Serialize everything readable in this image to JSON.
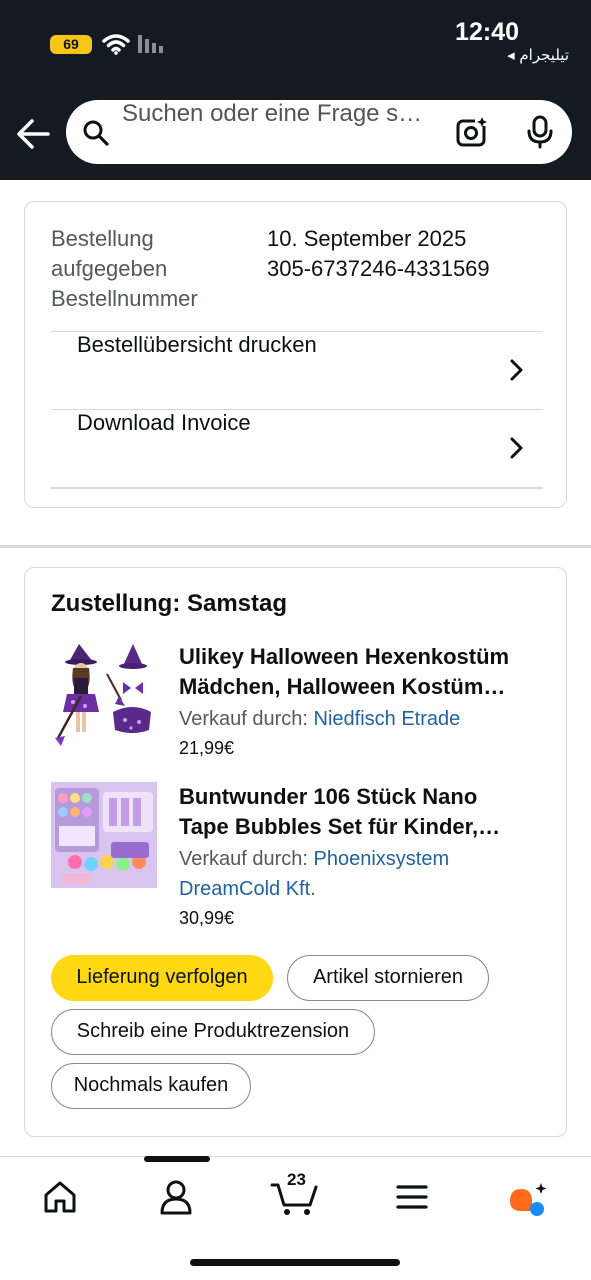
{
  "status_bar": {
    "battery": "69",
    "time": "12:40",
    "back_app": "◂ تيليجرام"
  },
  "search": {
    "placeholder": "Suchen oder eine Frage s…"
  },
  "order_info": {
    "labels": [
      "Bestellung",
      "aufgegeben",
      "Bestellnummer"
    ],
    "date": "10. September 2025",
    "number": "305-6737246-4331569",
    "actions": [
      {
        "label": "Bestellübersicht drucken"
      },
      {
        "label": "Download Invoice"
      }
    ]
  },
  "delivery": {
    "heading": "Zustellung: Samstag",
    "items": [
      {
        "title_line1": "Ulikey Halloween Hexenkostüm",
        "title_line2": "Mädchen, Halloween Kostüm…",
        "seller_prefix": "Verkauf durch: ",
        "seller_line1": "Niedfisch Etrade",
        "seller_line2": "",
        "price": "21,99€"
      },
      {
        "title_line1": "Buntwunder 106 Stück Nano",
        "title_line2": "Tape Bubbles Set für Kinder,…",
        "seller_prefix": "Verkauf durch: ",
        "seller_line1": "Phoenixsystem",
        "seller_line2": "DreamCold Kft.",
        "price": "30,99€"
      }
    ],
    "buttons": {
      "track": "Lieferung verfolgen",
      "cancel": "Artikel stornieren",
      "review": "Schreib eine Produktrezension",
      "buy_again": "Nochmals kaufen"
    }
  },
  "bottom_nav": {
    "cart_count": "23"
  },
  "colors": {
    "header_bg": "#131a22",
    "primary_button": "#ffd814",
    "link": "#2162a1",
    "battery": "#f5c518"
  }
}
